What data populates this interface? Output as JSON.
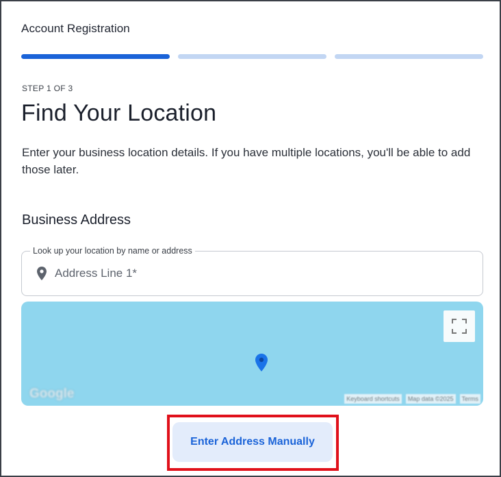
{
  "header": {
    "title": "Account Registration"
  },
  "progress": {
    "current_step": 1,
    "total_steps": 3
  },
  "step": {
    "label": "STEP 1 OF 3"
  },
  "page": {
    "title": "Find Your Location",
    "description": "Enter your business location details. If you have multiple locations, you'll be able to add those later."
  },
  "business_address": {
    "section_title": "Business Address",
    "field_legend": "Look up your location by name or address",
    "field_placeholder": "Address Line 1*",
    "field_value": ""
  },
  "map": {
    "logo": "Google",
    "attribution": [
      "Keyboard shortcuts",
      "Map data ©2025",
      "Terms"
    ],
    "water_color": "#8fd6ee",
    "marker_color": "#1a73e8"
  },
  "actions": {
    "manual_entry_label": "Enter Address Manually"
  },
  "colors": {
    "accent": "#1a63d8",
    "progress_inactive": "#c2d6f3",
    "button_bg": "#e3ecfb",
    "highlight": "#e0101a"
  }
}
